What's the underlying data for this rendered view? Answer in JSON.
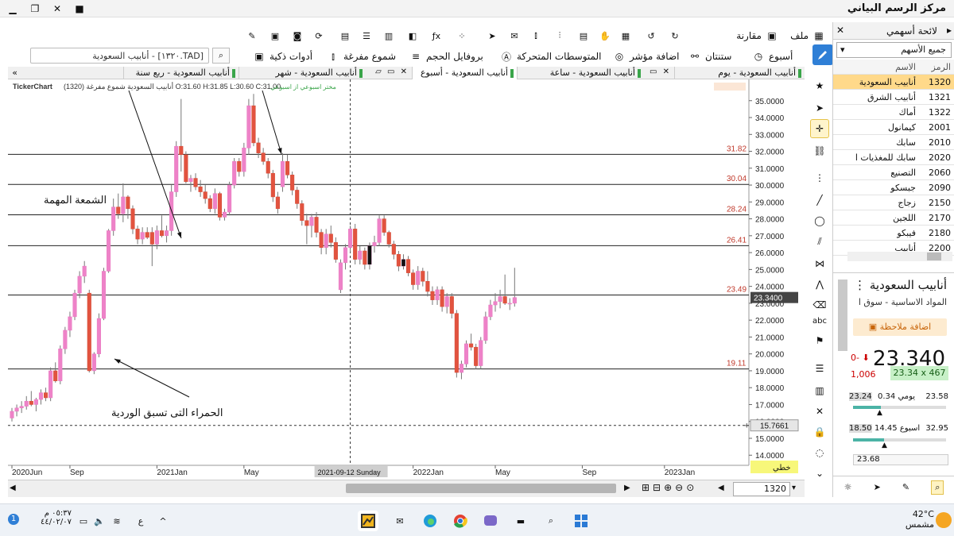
{
  "window": {
    "title": "مركز الرسم البياني"
  },
  "toolbar1": {
    "file": "ملف",
    "compare": "مقارنة",
    "week": "أسبوع",
    "stanton": "ستنتان",
    "add_indicator": "اضافة مؤشر",
    "moving_averages": "المتوسطات المتحركة",
    "volume_profile": "بروفايل الحجم",
    "hollow_candles": "شموع مفرغة",
    "smart_tools": "أدوات ذكية"
  },
  "search": {
    "value": "[TAD.١٣٢٠] - أنابيب السعودية"
  },
  "tabs": [
    {
      "label": "أنابيب السعودية - يوم"
    },
    {
      "label": "أنابيب السعودية - ساعة"
    },
    {
      "label": "أنابيب السعودية - أسبوع"
    },
    {
      "label": "أنابيب السعودية - شهر"
    },
    {
      "label": "أنابيب السعودية - ربع سنة"
    }
  ],
  "chart": {
    "info_line": "(1320) أنابيب السعودية شموع مفرغة O:31.60 H:31.85 L:30.60 C:31.00",
    "brand": "TickerChart",
    "hint": "مختر اسبوعي  از اسبوعي",
    "annotation_important": "الشمعة المهمة",
    "annotation_red": "الحمراء التى تسبق الوردية",
    "crosshair_date": "2021-09-12 Sunday",
    "current_price_label": "23.3400",
    "crosshair_price_label": "15.7661",
    "scale_type": "خطي",
    "symbol_box": "1320"
  },
  "chart_data": {
    "type": "candlestick",
    "symbol": "1320",
    "ylim": [
      13.4,
      35.6
    ],
    "y_ticks": [
      "35.0000",
      "34.0000",
      "33.0000",
      "32.0000",
      "31.0000",
      "30.0000",
      "29.0000",
      "28.0000",
      "27.0000",
      "26.0000",
      "25.0000",
      "24.0000",
      "23.0000",
      "22.0000",
      "21.0000",
      "20.0000",
      "19.0000",
      "18.0000",
      "17.0000",
      "16.0000",
      "15.0000",
      "14.0000"
    ],
    "x_ticks": [
      {
        "label": "2020Jun",
        "i": 0
      },
      {
        "label": "Sep",
        "i": 12
      },
      {
        "label": "2021Jan",
        "i": 30
      },
      {
        "label": "May",
        "i": 48
      },
      {
        "label": "2022Jan",
        "i": 83
      },
      {
        "label": "May",
        "i": 100
      },
      {
        "label": "Sep",
        "i": 118
      },
      {
        "label": "2023Jan",
        "i": 135
      }
    ],
    "levels": [
      31.82,
      30.04,
      28.24,
      26.41,
      23.49,
      19.11
    ],
    "current_price": 23.34,
    "candles": [
      [
        16.2,
        16.8,
        16.0,
        16.6
      ],
      [
        16.6,
        17.0,
        16.3,
        16.8
      ],
      [
        16.8,
        17.2,
        16.5,
        16.9
      ],
      [
        16.9,
        17.5,
        16.7,
        17.2
      ],
      [
        17.2,
        17.8,
        16.9,
        17.0
      ],
      [
        17.0,
        17.4,
        16.6,
        17.3
      ],
      [
        17.3,
        17.9,
        17.0,
        17.7
      ],
      [
        17.7,
        18.0,
        17.2,
        17.4
      ],
      [
        17.4,
        19.2,
        17.2,
        19.0
      ],
      [
        19.0,
        19.5,
        18.3,
        18.4
      ],
      [
        18.4,
        20.5,
        18.2,
        20.3
      ],
      [
        20.3,
        21.6,
        20.0,
        21.4
      ],
      [
        21.4,
        22.5,
        21.0,
        22.2
      ],
      [
        22.2,
        23.8,
        22.0,
        23.6
      ],
      [
        23.6,
        24.9,
        23.3,
        24.6
      ],
      [
        24.6,
        25.5,
        24.2,
        25.2
      ],
      [
        23.6,
        23.8,
        18.9,
        19.0
      ],
      [
        19.0,
        20.1,
        18.8,
        20.0
      ],
      [
        20.0,
        22.4,
        19.8,
        22.1
      ],
      [
        22.1,
        25.1,
        22.0,
        24.9
      ],
      [
        24.9,
        27.4,
        24.8,
        27.3
      ],
      [
        27.3,
        29.2,
        27.0,
        28.7
      ],
      [
        28.7,
        29.5,
        28.0,
        28.3
      ],
      [
        28.3,
        30.1,
        27.8,
        29.3
      ],
      [
        29.3,
        29.4,
        28.0,
        28.6
      ],
      [
        28.6,
        28.8,
        27.1,
        27.4
      ],
      [
        27.4,
        27.6,
        26.5,
        26.8
      ],
      [
        26.8,
        27.5,
        26.5,
        27.2
      ],
      [
        27.2,
        27.5,
        26.8,
        26.9
      ],
      [
        27.2,
        27.5,
        25.2,
        26.5
      ],
      [
        26.5,
        27.6,
        26.2,
        27.3
      ],
      [
        27.3,
        28.2,
        26.9,
        27.0
      ],
      [
        27.0,
        27.6,
        26.6,
        27.3
      ],
      [
        27.3,
        30.0,
        27.0,
        29.6
      ],
      [
        29.6,
        32.6,
        29.3,
        32.3
      ],
      [
        32.3,
        35.1,
        30.8,
        31.8
      ],
      [
        31.8,
        32.0,
        30.1,
        30.2
      ],
      [
        30.2,
        30.6,
        29.6,
        30.4
      ],
      [
        30.4,
        30.7,
        29.7,
        29.9
      ],
      [
        29.9,
        30.3,
        29.3,
        29.6
      ],
      [
        29.6,
        30.0,
        28.9,
        29.2
      ],
      [
        29.2,
        29.4,
        28.4,
        28.6
      ],
      [
        28.6,
        29.8,
        28.3,
        29.5
      ],
      [
        29.5,
        29.6,
        27.9,
        28.1
      ],
      [
        28.1,
        28.6,
        27.9,
        28.4
      ],
      [
        28.4,
        30.2,
        28.2,
        30.0
      ],
      [
        30.0,
        31.6,
        29.8,
        31.4
      ],
      [
        31.4,
        31.6,
        30.5,
        30.8
      ],
      [
        30.8,
        32.5,
        30.5,
        32.2
      ],
      [
        32.2,
        35.1,
        31.8,
        34.7
      ],
      [
        34.7,
        35.4,
        32.3,
        32.5
      ],
      [
        32.5,
        32.8,
        31.6,
        31.9
      ],
      [
        31.9,
        32.2,
        31.2,
        31.4
      ],
      [
        31.4,
        31.6,
        30.4,
        30.7
      ],
      [
        30.7,
        30.9,
        29.0,
        29.3
      ],
      [
        29.3,
        29.6,
        28.3,
        28.6
      ],
      [
        29.9,
        31.9,
        29.6,
        31.4
      ],
      [
        31.4,
        31.8,
        30.4,
        30.6
      ],
      [
        30.6,
        30.8,
        29.4,
        29.7
      ],
      [
        29.7,
        29.9,
        28.6,
        28.9
      ],
      [
        28.9,
        29.1,
        27.6,
        27.9
      ],
      [
        27.9,
        28.3,
        26.5,
        27.6
      ],
      [
        27.6,
        28.3,
        26.9,
        28.1
      ],
      [
        28.1,
        28.4,
        26.9,
        27.2
      ],
      [
        27.2,
        27.4,
        25.9,
        26.3
      ],
      [
        26.3,
        27.4,
        25.9,
        27.1
      ],
      [
        27.1,
        27.6,
        26.3,
        26.6
      ],
      [
        26.6,
        26.9,
        25.4,
        25.6
      ],
      [
        23.8,
        25.6,
        23.6,
        25.4
      ],
      [
        25.4,
        26.5,
        25.0,
        26.3
      ],
      [
        26.3,
        27.6,
        26.0,
        27.4
      ],
      [
        27.4,
        27.7,
        25.3,
        25.6
      ],
      [
        25.6,
        26.4,
        25.3,
        26.1
      ],
      [
        26.1,
        26.3,
        25.0,
        25.3
      ],
      [
        25.3,
        26.6,
        25.0,
        26.4
      ],
      [
        26.4,
        27.0,
        26.0,
        26.6
      ],
      [
        26.6,
        28.2,
        26.4,
        28.0
      ],
      [
        28.0,
        28.2,
        27.0,
        27.2
      ],
      [
        27.2,
        27.3,
        26.3,
        26.5
      ],
      [
        26.5,
        26.7,
        25.6,
        25.9
      ],
      [
        25.9,
        26.1,
        24.9,
        25.2
      ],
      [
        25.2,
        25.9,
        25.0,
        25.6
      ],
      [
        25.6,
        25.8,
        24.6,
        24.8
      ],
      [
        24.8,
        25.0,
        23.8,
        24.1
      ],
      [
        24.1,
        25.2,
        23.8,
        24.9
      ],
      [
        24.9,
        25.1,
        24.0,
        24.3
      ],
      [
        24.3,
        24.9,
        23.4,
        23.7
      ],
      [
        23.7,
        24.0,
        22.9,
        23.2
      ],
      [
        23.2,
        24.0,
        22.9,
        23.8
      ],
      [
        23.8,
        24.0,
        22.5,
        22.8
      ],
      [
        22.8,
        23.6,
        22.4,
        23.4
      ],
      [
        23.4,
        23.6,
        22.1,
        22.4
      ],
      [
        22.4,
        22.6,
        18.6,
        18.9
      ],
      [
        18.9,
        19.6,
        18.5,
        19.4
      ],
      [
        19.4,
        20.8,
        19.2,
        20.6
      ],
      [
        20.6,
        21.2,
        20.2,
        20.4
      ],
      [
        20.4,
        20.6,
        19.1,
        19.3
      ],
      [
        19.3,
        21.0,
        19.1,
        20.8
      ],
      [
        20.8,
        22.5,
        20.6,
        22.2
      ],
      [
        22.2,
        23.2,
        22.0,
        22.9
      ],
      [
        22.9,
        23.6,
        22.5,
        23.1
      ],
      [
        23.1,
        23.8,
        22.7,
        23.4
      ],
      [
        23.4,
        24.7,
        22.9,
        23.0
      ],
      [
        23.0,
        23.3,
        22.6,
        23.0
      ],
      [
        23.0,
        25.1,
        22.8,
        23.34
      ]
    ]
  },
  "vtools": {
    "labels": {
      "text_tool": "abc"
    }
  },
  "watchlist": {
    "title": "لائحة أسهمي",
    "dropdown": "جميع الأسهم",
    "header": {
      "symbol": "الرمز",
      "name": "الاسم"
    },
    "rows": [
      {
        "symbol": "1320",
        "name": "أنابيب السعودية",
        "selected": true
      },
      {
        "symbol": "1321",
        "name": "أنابيب الشرق"
      },
      {
        "symbol": "1322",
        "name": "أماك"
      },
      {
        "symbol": "2001",
        "name": "كيمانول"
      },
      {
        "symbol": "2010",
        "name": "سابك"
      },
      {
        "symbol": "2020",
        "name": "سابك للمغذيات ا"
      },
      {
        "symbol": "2060",
        "name": "التصنيع"
      },
      {
        "symbol": "2090",
        "name": "جبسكو"
      },
      {
        "symbol": "2150",
        "name": "زجاج"
      },
      {
        "symbol": "2170",
        "name": "اللجين"
      },
      {
        "symbol": "2180",
        "name": "فيبكو"
      },
      {
        "symbol": "2200",
        "name": "أنابيب"
      }
    ]
  },
  "quote": {
    "name": "أنابيب السعودية",
    "sector": "المواد الاساسية - سوق ا",
    "add_note": "اضافة ملاحظة",
    "price": "23.340",
    "change": "0-",
    "volume": "1,006",
    "bid": "23.34 x 467",
    "range_day": {
      "low": "23.24",
      "text": "يومي 0.34",
      "high": "23.58"
    },
    "range_week": {
      "low": "18.50",
      "text": "اسبوع 14.45",
      "high": "32.95"
    },
    "last": "23.68"
  },
  "taskbar": {
    "weather_temp": "42°C",
    "weather_desc": "مشمس",
    "time": "٠٥:٣٧ م",
    "date": "٤٤/٠٢/٠٧",
    "lang": "ع"
  }
}
